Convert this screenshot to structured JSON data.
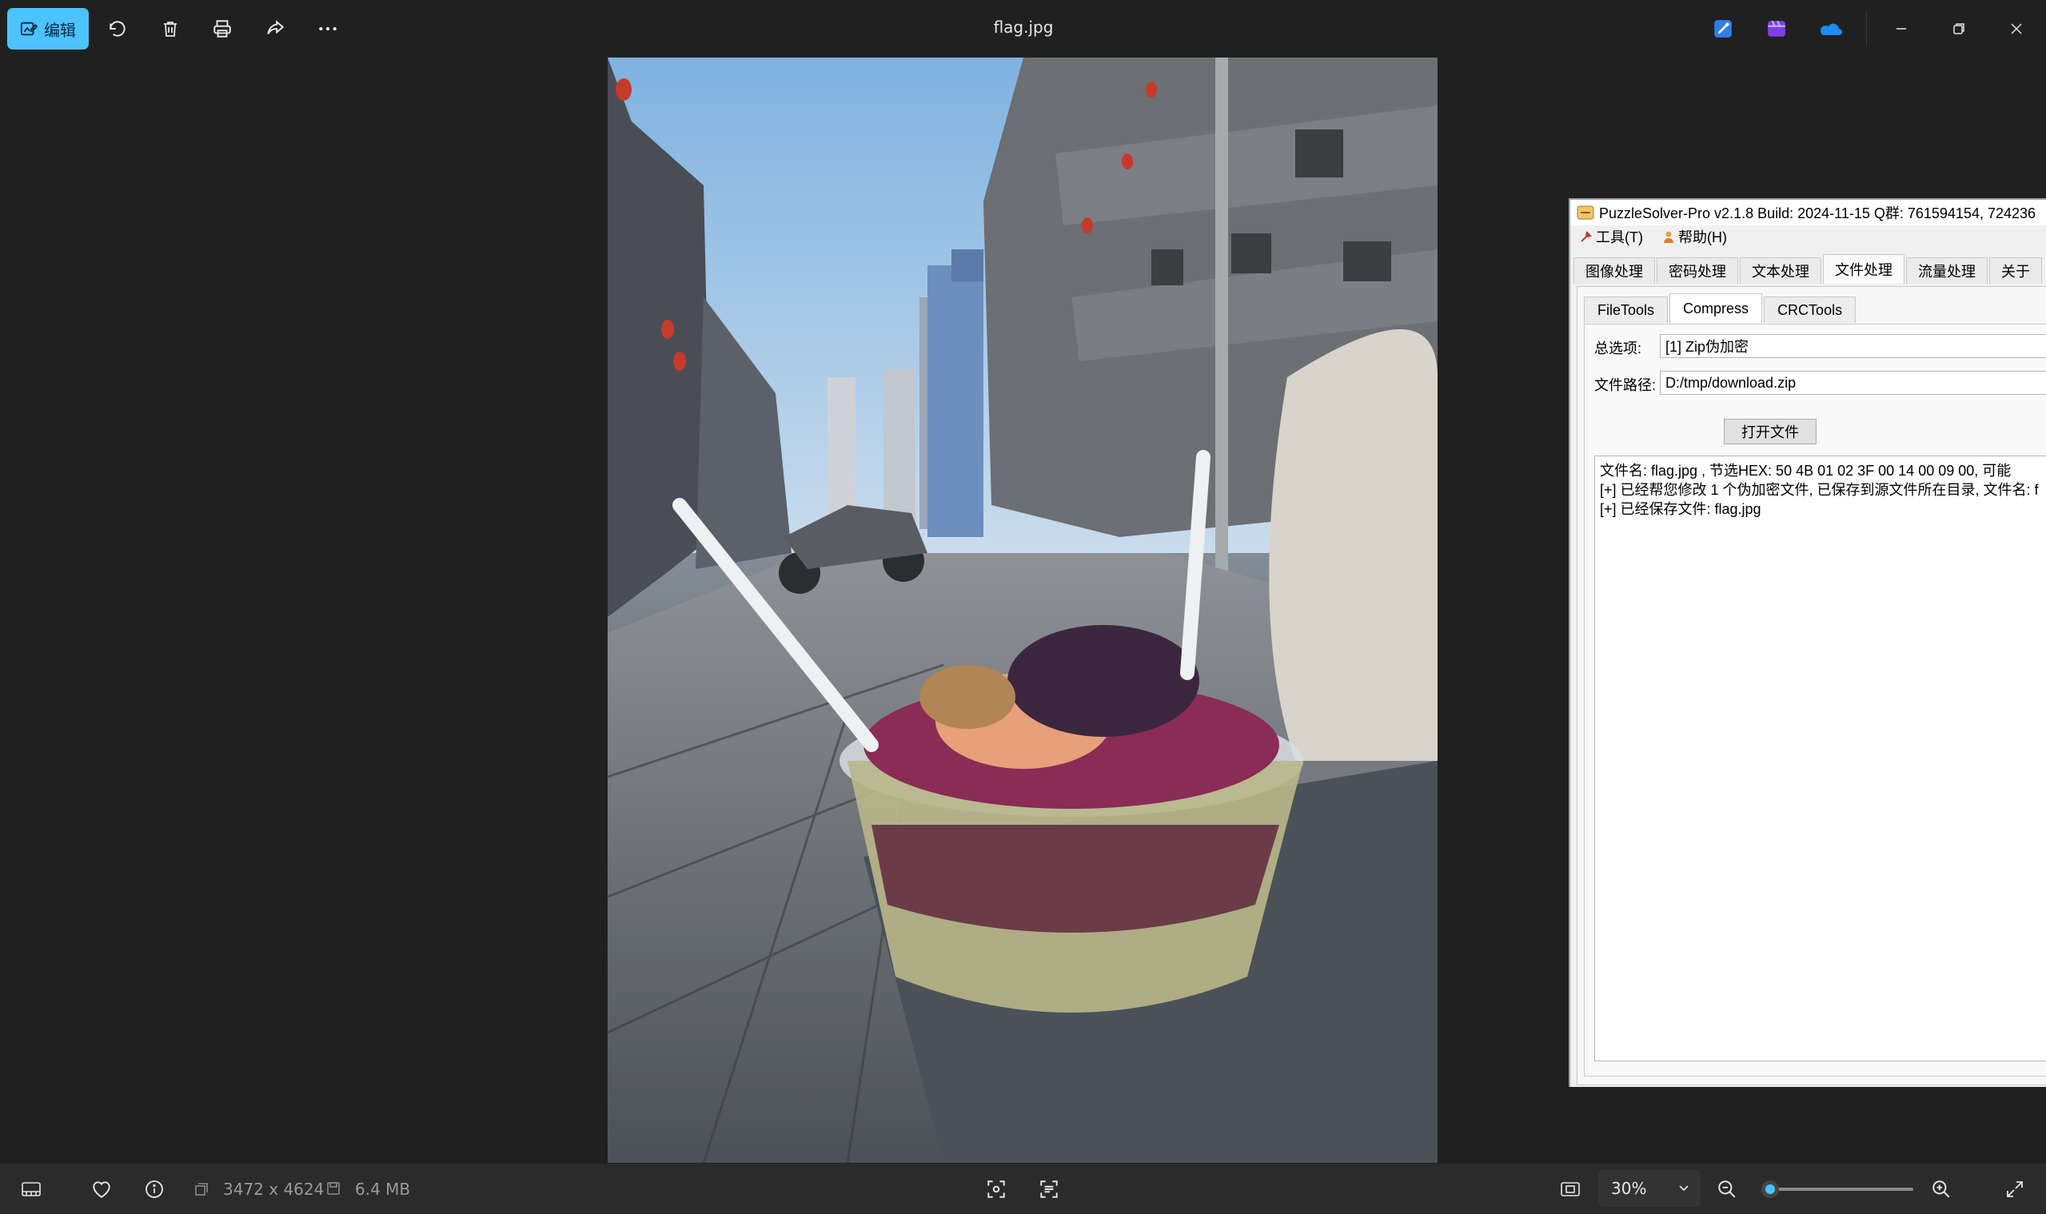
{
  "app": {
    "file_title": "flag.jpg"
  },
  "toolbar": {
    "edit_label": "编辑",
    "icons": [
      "edit-image-icon",
      "rotate-icon",
      "delete-icon",
      "print-icon",
      "share-icon",
      "more-icon"
    ]
  },
  "window_controls": {
    "icons": [
      "designer-icon",
      "clipchamp-icon",
      "onedrive-icon",
      "minimize-icon",
      "restore-icon",
      "close-icon"
    ]
  },
  "puzzlesolver": {
    "title": "PuzzleSolver-Pro v2.1.8  Build: 2024-11-15  Q群: 761594154, 724236",
    "menu": {
      "tools": "工具(T)",
      "help": "帮助(H)"
    },
    "tabs": [
      "图像处理",
      "密码处理",
      "文本处理",
      "文件处理",
      "流量处理",
      "关于"
    ],
    "active_tab": "文件处理",
    "subtabs": [
      "FileTools",
      "Compress",
      "CRCTools"
    ],
    "active_subtab": "Compress",
    "option_label": "总选项:",
    "option_value": "[1] Zip伪加密",
    "path_label": "文件路径:",
    "path_value": "D:/tmp/download.zip",
    "open_button": "打开文件",
    "log_lines": [
      "文件名: flag.jpg      , 节选HEX: 50 4B 01 02 3F 00 14 00 09 00, 可能",
      "[+] 已经帮您修改 1 个伪加密文件, 已保存到源文件所在目录, 文件名: f",
      "[+] 已经保存文件: flag.jpg"
    ]
  },
  "statusbar": {
    "dimensions": "3472 x 4624",
    "filesize": "6.4 MB",
    "zoom": "30%",
    "zoom_fraction": 0.06,
    "icons": [
      "filmstrip-icon",
      "favorite-icon",
      "info-icon",
      "dimensions-icon",
      "filesize-icon",
      "visual-search-icon",
      "text-scan-icon",
      "fit-icon",
      "chevron-down-icon",
      "zoom-out-icon",
      "zoom-in-icon",
      "fullscreen-icon"
    ]
  }
}
